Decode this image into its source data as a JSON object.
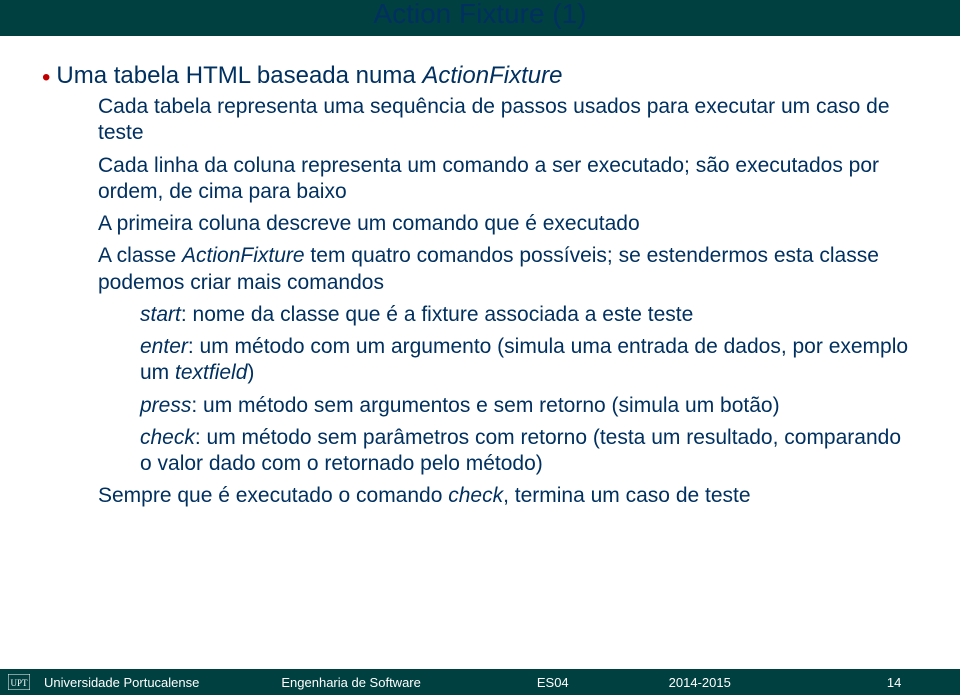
{
  "title": "Action Fixture (1)",
  "bullet_main": "Uma tabela HTML baseada numa ",
  "bullet_main_italic": "ActionFixture",
  "sub": {
    "s1": "Cada tabela representa uma sequência de passos usados para executar um caso de teste",
    "s2": "Cada linha da coluna representa um comando a ser executado; são executados por ordem, de cima para baixo",
    "s3_a": "A primeira coluna descreve um comando que é executado",
    "s4_a": "A classe ",
    "s4_i": "ActionFixture",
    "s4_b": " tem quatro comandos possíveis; se estendermos esta classe podemos criar mais comandos",
    "s9_a": "Sempre que é executado o comando ",
    "s9_i": "check",
    "s9_b": ", termina um caso de teste"
  },
  "sub2": {
    "c1_i": "start",
    "c1_t": ": nome da classe que é a fixture associada a este teste",
    "c2_i": "enter",
    "c2_t": ": um método com um argumento (simula uma entrada de dados, por exemplo um ",
    "c2_i2": "textfield",
    "c2_t2": ")",
    "c3_i": "press",
    "c3_t": ": um método sem argumentos e sem retorno (simula um botão)",
    "c4_i": "check",
    "c4_t": ": um método sem parâmetros com retorno (testa um resultado, comparando o valor dado com o retornado pelo método)"
  },
  "footer": {
    "uni": "Universidade Portucalense",
    "course": "Engenharia de Software",
    "code": "ES04",
    "year": "2014-2015",
    "page": "14"
  }
}
